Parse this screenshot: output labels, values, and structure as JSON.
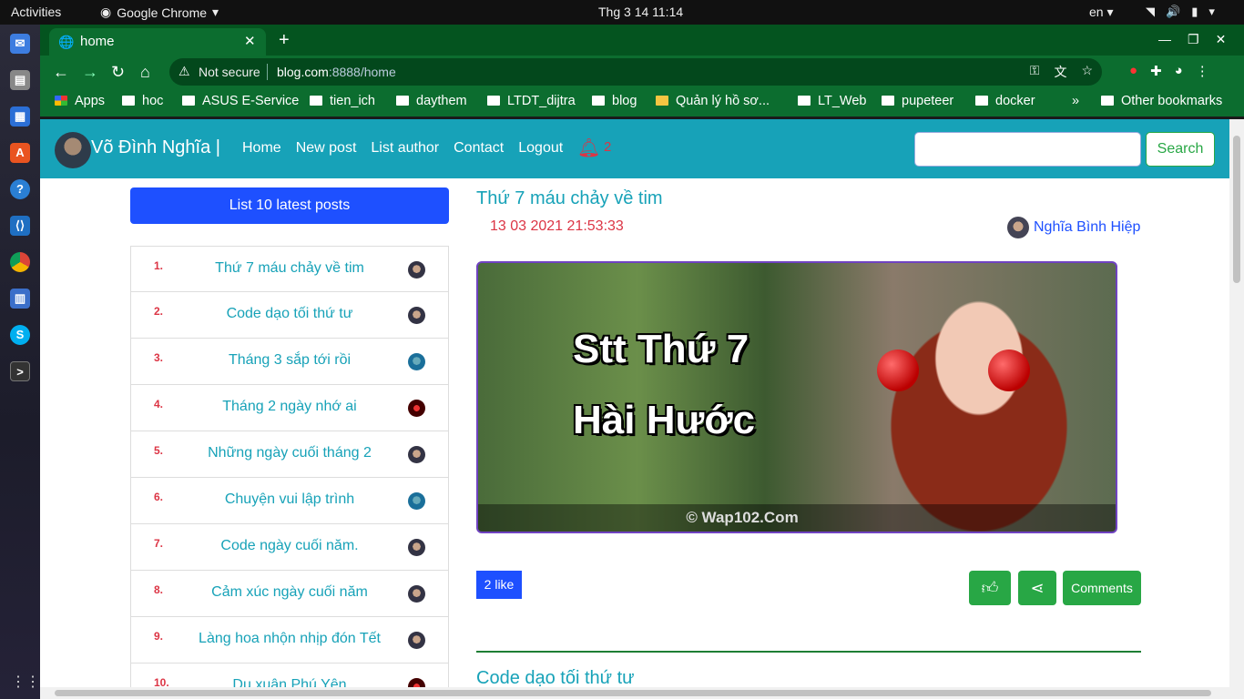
{
  "os": {
    "activities": "Activities",
    "app_name": "Google Chrome",
    "clock": "Thg 3 14  11:14",
    "language": "en"
  },
  "browser": {
    "tab_title": "home",
    "security_label": "Not secure",
    "url_host": "blog.com",
    "url_rest": ":8888/home",
    "bookmarks": [
      "Apps",
      "hoc",
      "ASUS E-Service",
      "tien_ich",
      "daythem",
      "LTDT_dijtra",
      "blog",
      "Quản lý hồ sơ...",
      "LT_Web",
      "pupeteer",
      "docker",
      "»",
      "Other bookmarks"
    ]
  },
  "site": {
    "brand": "Võ Đình Nghĩa |",
    "nav_links": [
      "Home",
      "New post",
      "List author",
      "Contact",
      "Logout"
    ],
    "notification_count": "2",
    "search_label": "Search"
  },
  "sidebar": {
    "header": "List 10 latest posts",
    "posts": [
      {
        "num": "1.",
        "title": "Thứ 7 máu chảy về tim"
      },
      {
        "num": "2.",
        "title": "Code dạo tối thứ tư"
      },
      {
        "num": "3.",
        "title": "Tháng 3 sắp tới rồi"
      },
      {
        "num": "4.",
        "title": "Tháng 2 ngày nhớ ai"
      },
      {
        "num": "5.",
        "title": "Những ngày cuối tháng 2"
      },
      {
        "num": "6.",
        "title": "Chuyện vui lập trình"
      },
      {
        "num": "7.",
        "title": "Code ngày cuối năm."
      },
      {
        "num": "8.",
        "title": "Cảm xúc ngày cuối năm"
      },
      {
        "num": "9.",
        "title": "Làng hoa nhộn nhịp đón Tết"
      },
      {
        "num": "10.",
        "title": "Du xuân Phú Yên"
      }
    ]
  },
  "post": {
    "title": "Thứ 7 máu chảy về tim",
    "date": "13 03 2021 21:53:33",
    "author": "Nghĩa Bình Hiệp",
    "image_text_1": "Stt Thứ 7",
    "image_text_2": "Hài Hước",
    "image_watermark": "© Wap102.Com",
    "likes": "2 like",
    "comments_label": "Comments"
  },
  "next_post": {
    "title": "Code dạo tối thứ tư"
  }
}
